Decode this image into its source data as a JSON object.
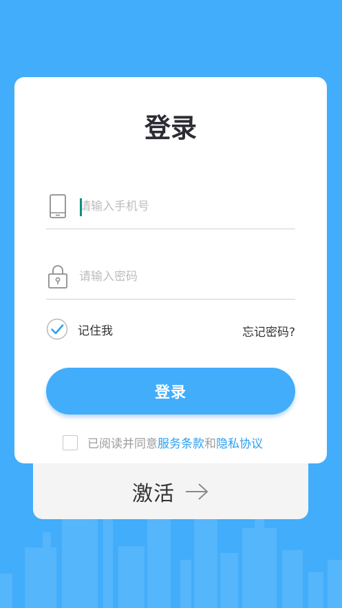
{
  "activate": {
    "label": "激活",
    "arrow_icon": "arrow-right-icon"
  },
  "login": {
    "title": "登录",
    "phone": {
      "icon": "phone-icon",
      "placeholder": "请输入手机号",
      "value": ""
    },
    "password": {
      "icon": "lock-icon",
      "placeholder": "请输入密码",
      "value": ""
    },
    "remember": {
      "icon": "check-circle-icon",
      "label": "记住我",
      "checked": true
    },
    "forgot_label": "忘记密码?",
    "button_label": "登录",
    "agreement": {
      "checked": false,
      "prefix": "已阅读并同意",
      "terms_link": "服务条款",
      "conjunction": "和",
      "privacy_link": "隐私协议"
    }
  },
  "colors": {
    "background": "#42adfb",
    "accent": "#42adfb",
    "link": "#2c9ff0",
    "card": "#ffffff",
    "activate_card": "#f4f4f4"
  }
}
